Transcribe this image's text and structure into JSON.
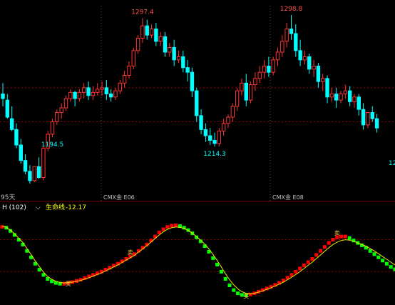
{
  "colors": {
    "background": "#000000",
    "up": "#ff3232",
    "down": "#00ffff",
    "grid": "#a00000",
    "high_label": "#ff5050",
    "low_label": "#00ffff",
    "axis_text": "#c0c0c0",
    "indicator_title": "#ffffff",
    "indicator_value": "#ffff00",
    "life_line": "#e8e800",
    "indicator_up": "#ff0000",
    "indicator_down": "#00ff00",
    "marker": "#ffd24a"
  },
  "labels": {
    "period": "95天",
    "indicator_name": "H (102)",
    "life_line_label": "生命线",
    "life_line_value": "-12.17",
    "month_tick_1": "CMX金 E06",
    "month_tick_2": "CMX金 E08",
    "right_edge_low": "12"
  },
  "chart_data": {
    "type": "candlestick",
    "ylim": [
      1185,
      1305
    ],
    "gridlines_y": [
      1252,
      1230
    ],
    "annotations": [
      {
        "text": "1297.4",
        "kind": "high",
        "index": 31
      },
      {
        "text": "1298.8",
        "kind": "high",
        "index": 64
      },
      {
        "text": "1214.3",
        "kind": "low",
        "index": 47
      },
      {
        "text": "1194.5",
        "kind": "low",
        "index": 11
      }
    ],
    "candles": [
      [
        1248,
        1255,
        1245,
        1240
      ],
      [
        1244,
        1248,
        1233,
        1232
      ],
      [
        1232,
        1240,
        1225,
        1224
      ],
      [
        1225,
        1229,
        1215,
        1213
      ],
      [
        1215,
        1219,
        1205,
        1203
      ],
      [
        1205,
        1209,
        1198,
        1196
      ],
      [
        1198,
        1202,
        1192,
        1190
      ],
      [
        1192,
        1200,
        1201,
        1191
      ],
      [
        1201,
        1207,
        1194,
        1193
      ],
      [
        1194,
        1214,
        1213,
        1192
      ],
      [
        1213,
        1224,
        1222,
        1211
      ],
      [
        1222,
        1232,
        1230,
        1220
      ],
      [
        1230,
        1238,
        1236,
        1228
      ],
      [
        1236,
        1242,
        1239,
        1232
      ],
      [
        1239,
        1247,
        1245,
        1237
      ],
      [
        1245,
        1251,
        1249,
        1243
      ],
      [
        1249,
        1250,
        1245,
        1240
      ],
      [
        1245,
        1251,
        1249,
        1243
      ],
      [
        1249,
        1255,
        1252,
        1245
      ],
      [
        1252,
        1256,
        1247,
        1244
      ],
      [
        1247,
        1253,
        1249,
        1244
      ],
      [
        1249,
        1255,
        1251,
        1247
      ],
      [
        1251,
        1256,
        1252,
        1247
      ],
      [
        1252,
        1257,
        1248,
        1244
      ],
      [
        1248,
        1251,
        1246,
        1243
      ],
      [
        1246,
        1252,
        1250,
        1244
      ],
      [
        1250,
        1257,
        1255,
        1248
      ],
      [
        1255,
        1263,
        1260,
        1252
      ],
      [
        1260,
        1269,
        1266,
        1258
      ],
      [
        1266,
        1278,
        1276,
        1264
      ],
      [
        1276,
        1286,
        1284,
        1274
      ],
      [
        1284,
        1297,
        1292,
        1281
      ],
      [
        1292,
        1296,
        1286,
        1283
      ],
      [
        1286,
        1293,
        1290,
        1284
      ],
      [
        1290,
        1294,
        1282,
        1279
      ],
      [
        1282,
        1288,
        1285,
        1279
      ],
      [
        1285,
        1288,
        1275,
        1272
      ],
      [
        1275,
        1281,
        1278,
        1272
      ],
      [
        1278,
        1283,
        1270,
        1266
      ],
      [
        1270,
        1276,
        1272,
        1268
      ],
      [
        1272,
        1276,
        1265,
        1262
      ],
      [
        1265,
        1270,
        1262,
        1256
      ],
      [
        1262,
        1265,
        1250,
        1246
      ],
      [
        1250,
        1252,
        1234,
        1230
      ],
      [
        1234,
        1238,
        1225,
        1222
      ],
      [
        1225,
        1229,
        1221,
        1217
      ],
      [
        1221,
        1226,
        1218,
        1215
      ],
      [
        1218,
        1223,
        1216,
        1214
      ],
      [
        1216,
        1226,
        1224,
        1214
      ],
      [
        1224,
        1232,
        1229,
        1221
      ],
      [
        1229,
        1235,
        1233,
        1226
      ],
      [
        1233,
        1242,
        1240,
        1230
      ],
      [
        1240,
        1252,
        1250,
        1237
      ],
      [
        1250,
        1258,
        1255,
        1247
      ],
      [
        1255,
        1261,
        1244,
        1240
      ],
      [
        1244,
        1256,
        1254,
        1242
      ],
      [
        1254,
        1262,
        1258,
        1250
      ],
      [
        1258,
        1266,
        1262,
        1255
      ],
      [
        1262,
        1270,
        1266,
        1258
      ],
      [
        1266,
        1272,
        1262,
        1259
      ],
      [
        1262,
        1272,
        1270,
        1260
      ],
      [
        1270,
        1278,
        1275,
        1266
      ],
      [
        1275,
        1286,
        1282,
        1272
      ],
      [
        1282,
        1294,
        1290,
        1278
      ],
      [
        1290,
        1299,
        1287,
        1283
      ],
      [
        1287,
        1293,
        1276,
        1272
      ],
      [
        1276,
        1283,
        1270,
        1266
      ],
      [
        1270,
        1276,
        1272,
        1267
      ],
      [
        1272,
        1274,
        1264,
        1261
      ],
      [
        1264,
        1270,
        1266,
        1259
      ],
      [
        1266,
        1268,
        1256,
        1252
      ],
      [
        1256,
        1261,
        1258,
        1250
      ],
      [
        1258,
        1260,
        1246,
        1242
      ],
      [
        1246,
        1252,
        1248,
        1243
      ],
      [
        1248,
        1252,
        1244,
        1239
      ],
      [
        1244,
        1250,
        1248,
        1242
      ],
      [
        1248,
        1254,
        1250,
        1245
      ],
      [
        1250,
        1253,
        1243,
        1240
      ],
      [
        1243,
        1248,
        1246,
        1239
      ],
      [
        1246,
        1248,
        1238,
        1234
      ],
      [
        1238,
        1242,
        1228,
        1225
      ],
      [
        1228,
        1234,
        1236,
        1226
      ],
      [
        1236,
        1240,
        1232,
        1230
      ],
      [
        1232,
        1235,
        1226,
        1223
      ]
    ],
    "indicator": {
      "name": "H (102)",
      "life_line_label": "生命线",
      "life_line_value": -12.17,
      "ylim": [
        -100,
        100
      ],
      "values": [
        72,
        70,
        62,
        52,
        40,
        28,
        12,
        -4,
        -20,
        -35,
        -48,
        -58,
        -64,
        -68,
        -70,
        -70,
        -68,
        -66,
        -63,
        -60,
        -56,
        -52,
        -48,
        -44,
        -40,
        -35,
        -30,
        -25,
        -20,
        -14,
        -8,
        -2,
        4,
        12,
        20,
        28,
        38,
        48,
        58,
        66,
        72,
        75,
        76,
        74,
        70,
        64,
        56,
        46,
        36,
        24,
        10,
        -6,
        -22,
        -40,
        -58,
        -74,
        -86,
        -94,
        -98,
        -99,
        -97,
        -94,
        -90,
        -86,
        -82,
        -78,
        -73,
        -68,
        -62,
        -55,
        -48,
        -40,
        -32,
        -24,
        -16,
        -8,
        2,
        12,
        22,
        32,
        40,
        46,
        48,
        48,
        44,
        38,
        32,
        26,
        20,
        12,
        4,
        -4,
        -12,
        -20,
        -28,
        -34
      ],
      "life_line": [
        74,
        71,
        64,
        55,
        44,
        33,
        18,
        3,
        -13,
        -27,
        -41,
        -52,
        -59,
        -64,
        -67,
        -68,
        -67,
        -66,
        -64,
        -62,
        -58,
        -55,
        -51,
        -47,
        -43,
        -38,
        -33,
        -28,
        -23,
        -17,
        -11,
        -5,
        1,
        9,
        17,
        25,
        34,
        43,
        52,
        60,
        66,
        70,
        72,
        71,
        68,
        63,
        56,
        48,
        39,
        29,
        17,
        3,
        -12,
        -28,
        -45,
        -60,
        -73,
        -83,
        -90,
        -94,
        -95,
        -94,
        -91,
        -88,
        -84,
        -80,
        -76,
        -71,
        -66,
        -60,
        -54,
        -47,
        -40,
        -32,
        -24,
        -16,
        -7,
        2,
        11,
        20,
        28,
        34,
        38,
        40,
        39,
        36,
        32,
        28,
        24,
        18,
        12,
        5,
        -2,
        -9,
        -16,
        -23
      ],
      "markers": [
        {
          "text": "卖",
          "index": 31
        },
        {
          "text": "买",
          "index": 16
        },
        {
          "text": "买",
          "index": 59
        },
        {
          "text": "卖",
          "index": 81
        }
      ]
    }
  }
}
